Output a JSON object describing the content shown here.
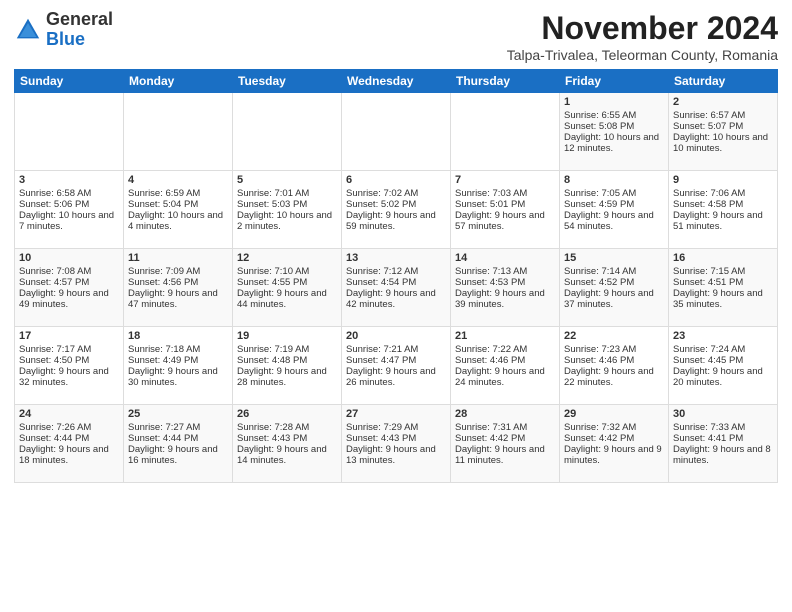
{
  "header": {
    "logo": {
      "line1": "General",
      "line2": "Blue"
    },
    "month": "November 2024",
    "location": "Talpa-Trivalea, Teleorman County, Romania"
  },
  "days_of_week": [
    "Sunday",
    "Monday",
    "Tuesday",
    "Wednesday",
    "Thursday",
    "Friday",
    "Saturday"
  ],
  "weeks": [
    [
      {
        "day": "",
        "info": ""
      },
      {
        "day": "",
        "info": ""
      },
      {
        "day": "",
        "info": ""
      },
      {
        "day": "",
        "info": ""
      },
      {
        "day": "",
        "info": ""
      },
      {
        "day": "1",
        "info": "Sunrise: 6:55 AM\nSunset: 5:08 PM\nDaylight: 10 hours and 12 minutes."
      },
      {
        "day": "2",
        "info": "Sunrise: 6:57 AM\nSunset: 5:07 PM\nDaylight: 10 hours and 10 minutes."
      }
    ],
    [
      {
        "day": "3",
        "info": "Sunrise: 6:58 AM\nSunset: 5:06 PM\nDaylight: 10 hours and 7 minutes."
      },
      {
        "day": "4",
        "info": "Sunrise: 6:59 AM\nSunset: 5:04 PM\nDaylight: 10 hours and 4 minutes."
      },
      {
        "day": "5",
        "info": "Sunrise: 7:01 AM\nSunset: 5:03 PM\nDaylight: 10 hours and 2 minutes."
      },
      {
        "day": "6",
        "info": "Sunrise: 7:02 AM\nSunset: 5:02 PM\nDaylight: 9 hours and 59 minutes."
      },
      {
        "day": "7",
        "info": "Sunrise: 7:03 AM\nSunset: 5:01 PM\nDaylight: 9 hours and 57 minutes."
      },
      {
        "day": "8",
        "info": "Sunrise: 7:05 AM\nSunset: 4:59 PM\nDaylight: 9 hours and 54 minutes."
      },
      {
        "day": "9",
        "info": "Sunrise: 7:06 AM\nSunset: 4:58 PM\nDaylight: 9 hours and 51 minutes."
      }
    ],
    [
      {
        "day": "10",
        "info": "Sunrise: 7:08 AM\nSunset: 4:57 PM\nDaylight: 9 hours and 49 minutes."
      },
      {
        "day": "11",
        "info": "Sunrise: 7:09 AM\nSunset: 4:56 PM\nDaylight: 9 hours and 47 minutes."
      },
      {
        "day": "12",
        "info": "Sunrise: 7:10 AM\nSunset: 4:55 PM\nDaylight: 9 hours and 44 minutes."
      },
      {
        "day": "13",
        "info": "Sunrise: 7:12 AM\nSunset: 4:54 PM\nDaylight: 9 hours and 42 minutes."
      },
      {
        "day": "14",
        "info": "Sunrise: 7:13 AM\nSunset: 4:53 PM\nDaylight: 9 hours and 39 minutes."
      },
      {
        "day": "15",
        "info": "Sunrise: 7:14 AM\nSunset: 4:52 PM\nDaylight: 9 hours and 37 minutes."
      },
      {
        "day": "16",
        "info": "Sunrise: 7:15 AM\nSunset: 4:51 PM\nDaylight: 9 hours and 35 minutes."
      }
    ],
    [
      {
        "day": "17",
        "info": "Sunrise: 7:17 AM\nSunset: 4:50 PM\nDaylight: 9 hours and 32 minutes."
      },
      {
        "day": "18",
        "info": "Sunrise: 7:18 AM\nSunset: 4:49 PM\nDaylight: 9 hours and 30 minutes."
      },
      {
        "day": "19",
        "info": "Sunrise: 7:19 AM\nSunset: 4:48 PM\nDaylight: 9 hours and 28 minutes."
      },
      {
        "day": "20",
        "info": "Sunrise: 7:21 AM\nSunset: 4:47 PM\nDaylight: 9 hours and 26 minutes."
      },
      {
        "day": "21",
        "info": "Sunrise: 7:22 AM\nSunset: 4:46 PM\nDaylight: 9 hours and 24 minutes."
      },
      {
        "day": "22",
        "info": "Sunrise: 7:23 AM\nSunset: 4:46 PM\nDaylight: 9 hours and 22 minutes."
      },
      {
        "day": "23",
        "info": "Sunrise: 7:24 AM\nSunset: 4:45 PM\nDaylight: 9 hours and 20 minutes."
      }
    ],
    [
      {
        "day": "24",
        "info": "Sunrise: 7:26 AM\nSunset: 4:44 PM\nDaylight: 9 hours and 18 minutes."
      },
      {
        "day": "25",
        "info": "Sunrise: 7:27 AM\nSunset: 4:44 PM\nDaylight: 9 hours and 16 minutes."
      },
      {
        "day": "26",
        "info": "Sunrise: 7:28 AM\nSunset: 4:43 PM\nDaylight: 9 hours and 14 minutes."
      },
      {
        "day": "27",
        "info": "Sunrise: 7:29 AM\nSunset: 4:43 PM\nDaylight: 9 hours and 13 minutes."
      },
      {
        "day": "28",
        "info": "Sunrise: 7:31 AM\nSunset: 4:42 PM\nDaylight: 9 hours and 11 minutes."
      },
      {
        "day": "29",
        "info": "Sunrise: 7:32 AM\nSunset: 4:42 PM\nDaylight: 9 hours and 9 minutes."
      },
      {
        "day": "30",
        "info": "Sunrise: 7:33 AM\nSunset: 4:41 PM\nDaylight: 9 hours and 8 minutes."
      }
    ]
  ]
}
